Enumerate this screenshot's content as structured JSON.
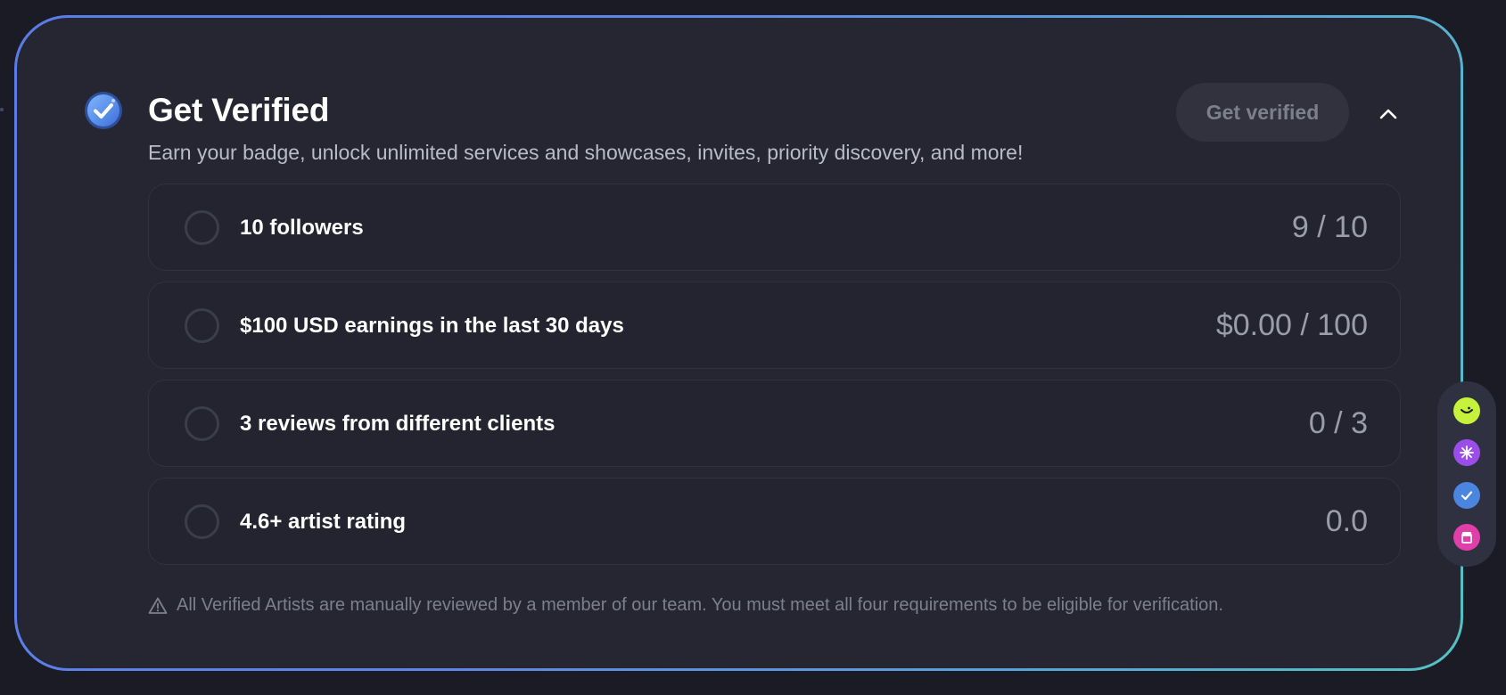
{
  "header": {
    "title": "Get Verified",
    "subtitle": "Earn your badge, unlock unlimited services and showcases, invites, priority discovery, and more!",
    "verify_button_label": "Get verified"
  },
  "requirements": [
    {
      "label": "10 followers",
      "value": "9 / 10"
    },
    {
      "label": "$100 USD earnings in the last 30 days",
      "value": "$0.00 / 100"
    },
    {
      "label": "3 reviews from different clients",
      "value": "0 / 3"
    },
    {
      "label": "4.6+ artist rating",
      "value": "0.0"
    }
  ],
  "note": "All Verified Artists are manually reviewed by a member of our team. You must meet all four requirements to be eligible for verification.",
  "icons": {
    "badge": "verified-badge-icon",
    "collapse": "chevron-up-icon",
    "warning": "warning-triangle-icon",
    "dock": [
      "lime-face-icon",
      "purple-sparkle-icon",
      "blue-check-icon",
      "pink-store-icon"
    ]
  },
  "colors": {
    "background": "#1b1b25",
    "card": "#252632",
    "border_gradient_start": "#5a7ce8",
    "border_gradient_end": "#55c2c2",
    "accent_blue": "#4a86e0",
    "dock_lime": "#c6f23c",
    "dock_purple": "#9a4de8",
    "dock_blue": "#4a86e0",
    "dock_pink": "#e03ea8"
  }
}
